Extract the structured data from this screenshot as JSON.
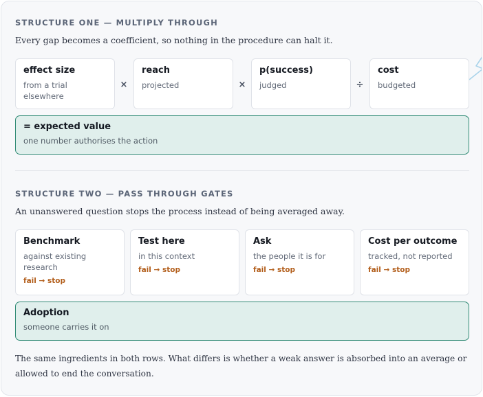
{
  "structure_one": {
    "title": "STRUCTURE ONE — MULTIPLY THROUGH",
    "subtitle": "Every gap becomes a coefficient, so nothing in the procedure can halt it.",
    "factors": [
      {
        "title": "effect size",
        "sub": "from a trial elsewhere"
      },
      {
        "title": "reach",
        "sub": "projected"
      },
      {
        "title": "p(success)",
        "sub": "judged"
      },
      {
        "title": "cost",
        "sub": "budgeted"
      }
    ],
    "operators": [
      "×",
      "×",
      "÷"
    ],
    "result": {
      "title": "= expected value",
      "sub": "one number authorises the action"
    }
  },
  "structure_two": {
    "title": "STRUCTURE TWO — PASS THROUGH GATES",
    "subtitle": "An unanswered question stops the process instead of being averaged away.",
    "gates": [
      {
        "title": "Benchmark",
        "sub": "against existing research",
        "fail": "fail → stop"
      },
      {
        "title": "Test here",
        "sub": "in this context",
        "fail": "fail → stop"
      },
      {
        "title": "Ask",
        "sub": "the people it is for",
        "fail": "fail → stop"
      },
      {
        "title": "Cost per outcome",
        "sub": "tracked, not reported",
        "fail": "fail → stop"
      }
    ],
    "result": {
      "title": "Adoption",
      "sub": "someone carries it on"
    }
  },
  "footer": "The same ingredients in both rows. What differs is whether a weak answer is absorbed into an average or allowed to end the conversation.",
  "colors": {
    "result_fill": "#e0efec",
    "result_border": "#2f8a74",
    "fail_text": "#b25e1b"
  }
}
